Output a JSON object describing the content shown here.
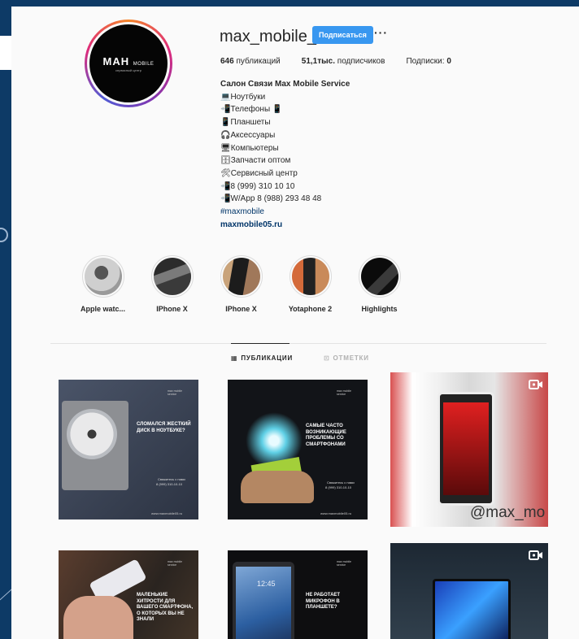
{
  "profile": {
    "username": "max_mobile_",
    "follow_label": "Подписаться",
    "more_label": "···",
    "avatar_logo": "MAH",
    "avatar_logo_suffix": "MOBILE",
    "avatar_tagline": "сервисный центр"
  },
  "stats": {
    "posts_count": "646",
    "posts_label": "публикаций",
    "followers_count": "51,1тыс.",
    "followers_label": "подписчиков",
    "following_label": "Подписки:",
    "following_count": "0"
  },
  "bio": {
    "name": "Салон Связи Max Mobile Service",
    "lines": [
      {
        "icon": "laptop-icon",
        "text": "Ноутбуки"
      },
      {
        "icon": "phone-icon",
        "text": "Телефоны 📱"
      },
      {
        "icon": "tablet-icon",
        "text": "Планшеты"
      },
      {
        "icon": "headphones-icon",
        "text": "Аксессуары"
      },
      {
        "icon": "computer-icon",
        "text": "Компьютеры"
      },
      {
        "icon": "box-icon",
        "text": "Запчасти оптом"
      },
      {
        "icon": "tools-icon",
        "text": "Сервисный центр"
      },
      {
        "icon": "phone-icon",
        "text": "8 (999) 310 10 10"
      },
      {
        "icon": "phone-icon",
        "text": "W/App 8 (988) 293 48 48"
      }
    ],
    "hashtag": "#maxmobile",
    "website": "maxmobile05.ru"
  },
  "highlights": [
    {
      "label": "Apple watc...",
      "color": "#d9d9d9"
    },
    {
      "label": "IPhone X",
      "color": "#6b6b6b"
    },
    {
      "label": "IPhone X",
      "color": "#8a6a4a"
    },
    {
      "label": "Yotaphone 2",
      "color": "#b05a3a"
    },
    {
      "label": "Highlights",
      "color": "#1a1a1a"
    }
  ],
  "tabs": [
    {
      "label": "ПУБЛИКАЦИИ",
      "icon": "grid-icon",
      "active": true
    },
    {
      "label": "ОТМЕТКИ",
      "icon": "tag-icon",
      "active": false
    }
  ],
  "posts": {
    "hdd": {
      "headline": "СЛОМАЛСЯ ЖЕСТКИЙ ДИСК В НОУТБУКЕ?",
      "sub": "Свяжитесь с нами",
      "phone": "8 (999) 310-10-10",
      "url": "www.maxmobile05.ru",
      "brand": "max mobile service"
    },
    "bulb": {
      "headline": "САМЫЕ ЧАСТО ВОЗНИКАЮЩИЕ ПРОБЛЕМЫ СО СМАРТФОНАМИ",
      "sub": "Свяжитесь с нами",
      "phone": "8 (999) 310-10-10",
      "url": "www.maxmobile05.ru",
      "brand": "max mobile service"
    },
    "screens": {
      "watermark": "@max_mo"
    },
    "tips": {
      "headline": "МАЛЕНЬКИЕ ХИТРОСТИ ДЛЯ ВАШЕГО СМАРТФОНА, О КОТОРЫХ ВЫ НЕ ЗНАЛИ",
      "brand": "max mobile service"
    },
    "tablet": {
      "headline": "НЕ РАБОТАЕТ МИКРОФОН В ПЛАНШЕТЕ?",
      "screen_time": "12:45",
      "brand": "max mobile service"
    }
  },
  "colors": {
    "accent": "#3897f0",
    "link": "#003569",
    "page_bg": "#0d3a66",
    "card_bg": "#fafafa"
  }
}
